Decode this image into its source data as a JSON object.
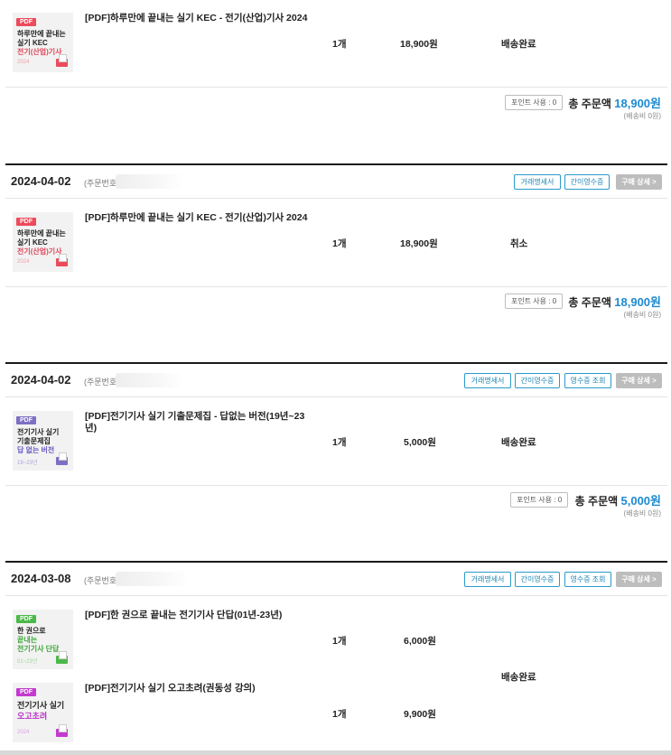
{
  "labels": {
    "order_no": "(주문번호",
    "btn_trade": "거래명세서",
    "btn_simple_receipt": "간이영수증",
    "btn_receipt_view": "영수증 조회",
    "btn_detail": "구매 상세 >",
    "points": "포인트 사용 : 0",
    "total_prefix": "총 주문액",
    "shipping": "(배송비 0원)"
  },
  "colors": {
    "accent": "#1d8ad0",
    "button_border": "#2a9ac9",
    "divider": "#1a1a1a"
  },
  "orders": [
    {
      "items": [
        {
          "name": "[PDF]하루만에 끝내는 실기 KEC - 전기(산업)기사 2024",
          "qty": "1개",
          "price": "18,900원",
          "status": "배송완료"
        }
      ],
      "total": "18,900원"
    },
    {
      "date": "2024-04-02",
      "items": [
        {
          "name": "[PDF]하루만에 끝내는 실기 KEC - 전기(산업)기사 2024",
          "qty": "1개",
          "price": "18,900원",
          "status": "취소"
        }
      ],
      "total": "18,900원"
    },
    {
      "date": "2024-04-02",
      "items": [
        {
          "name": "[PDF]전기기사 실기 기출문제집 - 답없는 버전(19년~23",
          "name2": "년)",
          "qty": "1개",
          "price": "5,000원",
          "status": "배송완료"
        }
      ],
      "total": "5,000원"
    },
    {
      "date": "2024-03-08",
      "items": [
        {
          "name": "[PDF]한 권으로 끝내는 전기기사 단답(01년-23년)",
          "qty": "1개",
          "price": "6,000원"
        },
        {
          "name": "[PDF]전기기사 실기 오고초려(권동성 강의)",
          "qty": "1개",
          "price": "9,900원"
        }
      ],
      "status": "배송완료"
    }
  ],
  "thumbs": {
    "kec": {
      "tag": "PDF",
      "lines": [
        "하루만에 끝내는",
        "실기 KEC",
        "전기(산업)기사"
      ],
      "sub": "2024"
    },
    "kec2": {
      "tag": "PDF",
      "lines": [
        "하루만에 끝내는",
        "실기 KEC",
        "전기(산업)기사"
      ],
      "sub": "2024"
    },
    "exam": {
      "tag": "PDF",
      "lines": [
        "전기기사 실기",
        "기출문제집",
        "답 없는 버전"
      ],
      "sub": "19~23년"
    },
    "short": {
      "tag": "PDF",
      "lines": [
        "한 권으로",
        "끝내는",
        "전기기사 단답"
      ],
      "sub": "01~23년"
    },
    "ogo": {
      "tag": "PDF",
      "lines": [
        "전기기사 실기",
        "오고초려"
      ],
      "sub": "2024"
    }
  }
}
